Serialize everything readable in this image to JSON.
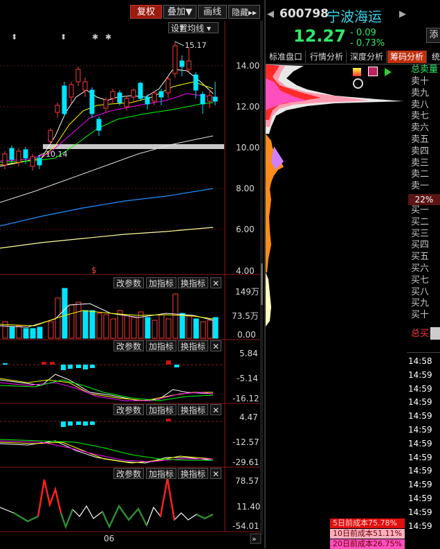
{
  "toolbar": {
    "fuquan": "复权",
    "diejia": "叠加▼",
    "huaxian": "画线",
    "yincang": "隐藏▸▸",
    "ma_setting": "设置均线"
  },
  "stock": {
    "code": "600798",
    "name": "宁波海运",
    "price": "12.27",
    "change": "- 0.09",
    "pct": "- 0.73%",
    "extra_btn": "添"
  },
  "tabs": [
    "标准盘口",
    "行情分析",
    "深度分析",
    "筹码分析",
    "统"
  ],
  "chart_labels": {
    "high": "15.17",
    "low": "10.14",
    "marker": "$",
    "date": "06"
  },
  "price_axis": [
    "14.00",
    "12.00",
    "10.00",
    "8.00",
    "6.00",
    "4.00"
  ],
  "panel_buttons": {
    "param": "改参数",
    "add": "加指标",
    "swap": "换指标",
    "close": "✕"
  },
  "vol_axis": [
    "149万",
    "73.5万",
    "0.00"
  ],
  "ind1_axis": [
    "5.84",
    "-5.14",
    "-16.12"
  ],
  "ind2_axis": [
    "4.47",
    "-12.57",
    "-29.61"
  ],
  "ind3_axis": [
    "78.57",
    "11.40",
    "-54.01"
  ],
  "orderbook": {
    "sell_total": "总卖量",
    "sells": [
      "卖十",
      "卖九",
      "卖八",
      "卖七",
      "卖六",
      "卖五",
      "卖四",
      "卖三",
      "卖二",
      "卖一"
    ],
    "ratio": "22%",
    "buys": [
      "买一",
      "买二",
      "买三",
      "买四",
      "买五",
      "买六",
      "买七",
      "买八",
      "买九",
      "买十"
    ],
    "buy_total": "总买量"
  },
  "times": [
    "14:58",
    "14:59",
    "14:59",
    "14:59",
    "14:59",
    "14:59",
    "14:59",
    "14:59",
    "14:59",
    "14:59",
    "14:59",
    "14:59",
    "14:59"
  ],
  "cost_legend": [
    "5日前成本75.78%",
    "10日前成本51.11%",
    "20日前成本26.75%"
  ],
  "colors": {
    "up": "#ff3b3b",
    "down": "#00e5ff",
    "ma5": "#ffffff",
    "ma10": "#ffff00",
    "ma20": "#ff00ff",
    "ma30": "#00ff00",
    "ma60": "#1e90ff"
  }
}
